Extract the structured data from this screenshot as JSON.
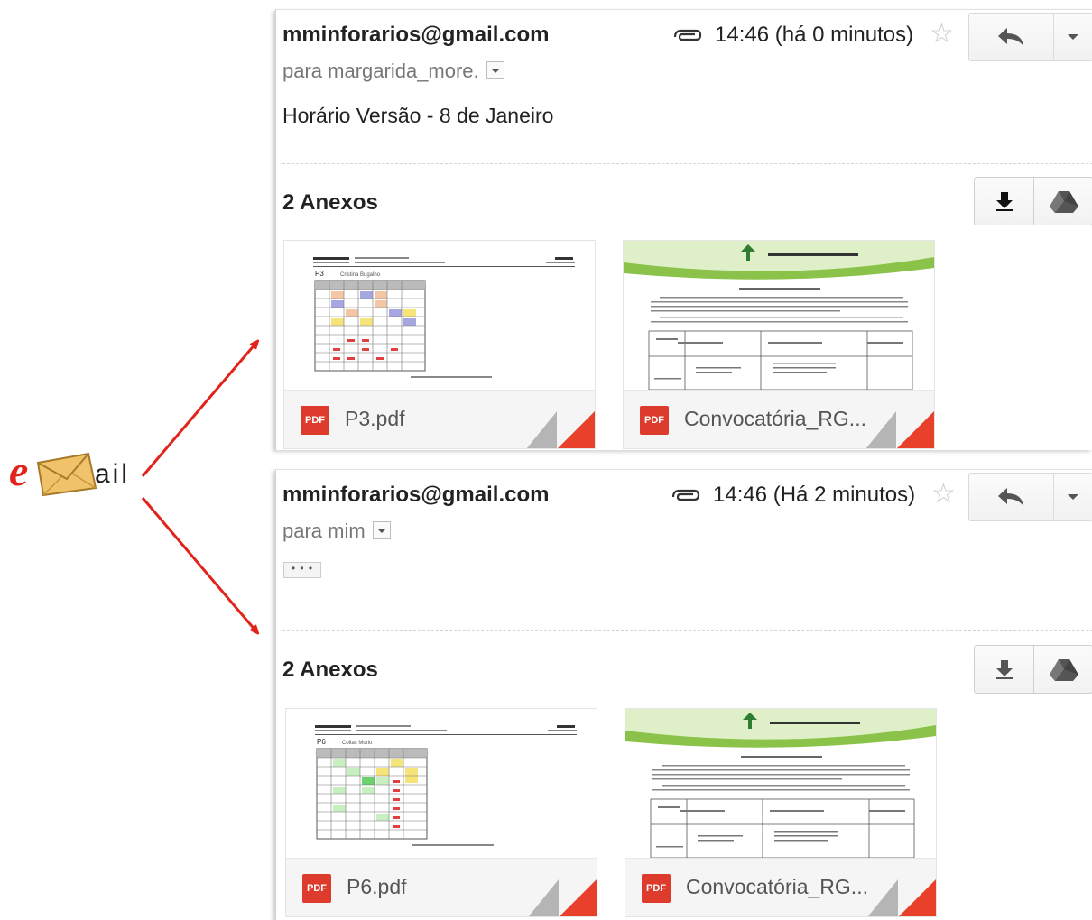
{
  "logo": {
    "e_letter": "e",
    "rest": "ail"
  },
  "emails": [
    {
      "sender": "mminforarios@gmail.com",
      "to": "para margarida_more.",
      "subject": "Horário Versão - 8 de Janeiro",
      "time": "14:46 (há 0 minutos)",
      "annexes_title": "2 Anexos",
      "attachments": [
        {
          "name": "P3.pdf",
          "badge": "PDF",
          "preview_title": "P3",
          "preview_name": "Cristina Bugalho"
        },
        {
          "name": "Convocatória_RG...",
          "badge": "PDF"
        }
      ]
    },
    {
      "sender": "mminforarios@gmail.com",
      "to": "para mim",
      "subject": "",
      "ellipsis": "• • •",
      "time": "14:46 (Há 2 minutos)",
      "annexes_title": "2 Anexos",
      "attachments": [
        {
          "name": "P6.pdf",
          "badge": "PDF",
          "preview_title": "P6",
          "preview_name": "Colias Morio"
        },
        {
          "name": "Convocatória_RG...",
          "badge": "PDF"
        }
      ]
    }
  ],
  "colors": {
    "arrow": "#e2231a",
    "pdf_red": "#dd3b2c",
    "corner_red": "#e8402a",
    "doc_header_green": "#8bc34a"
  }
}
